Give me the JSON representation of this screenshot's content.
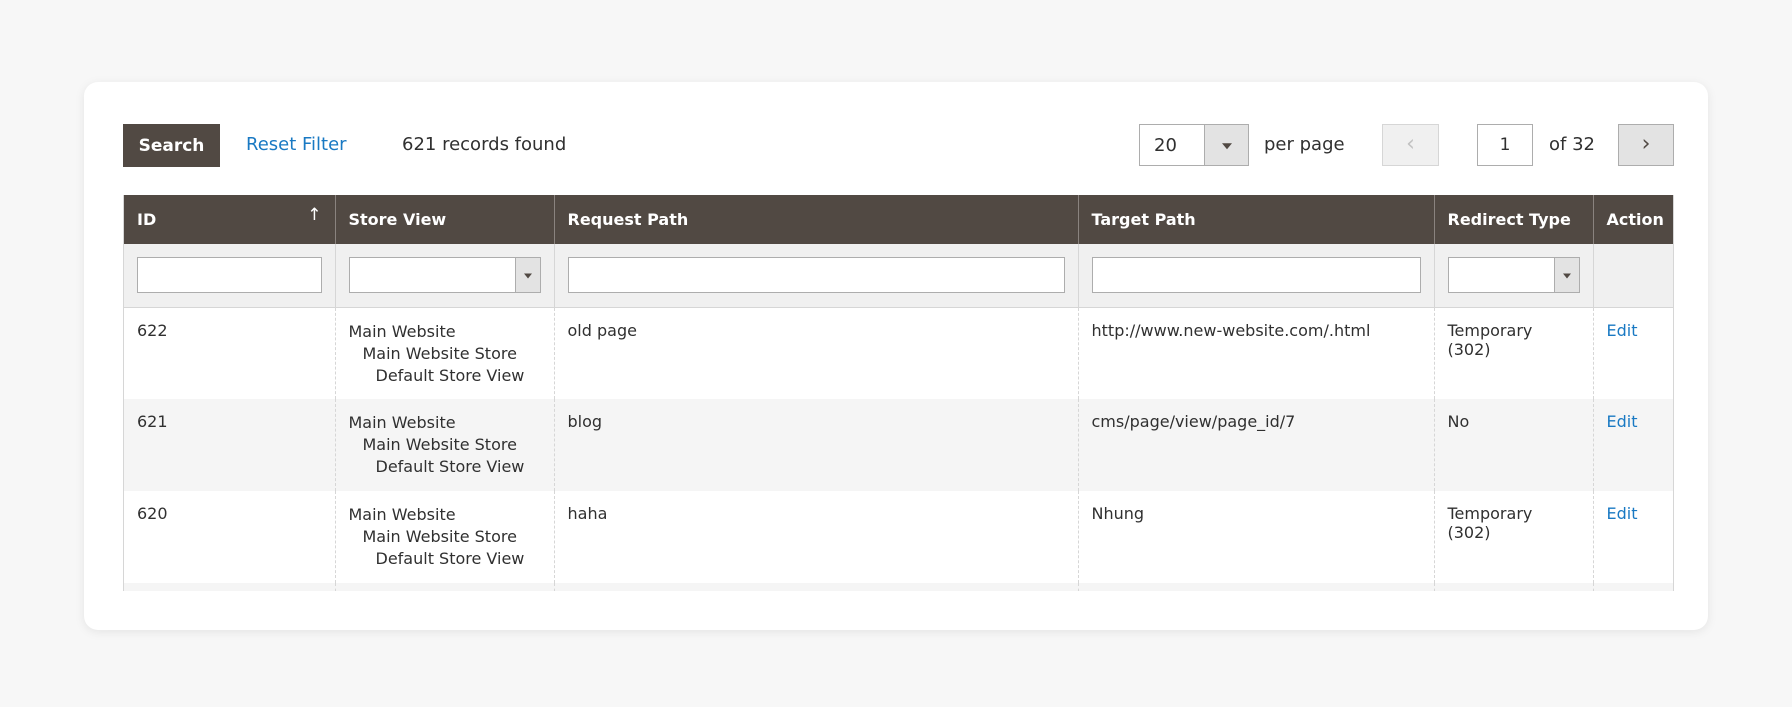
{
  "toolbar": {
    "search_label": "Search",
    "reset_label": "Reset Filter",
    "records_text": "621 records found",
    "per_page_value": "20",
    "per_page_label": "per page",
    "page_value": "1",
    "of_label": "of 32",
    "prev_symbol": "‹",
    "next_symbol": "›"
  },
  "grid": {
    "columns": [
      "ID",
      "Store View",
      "Request Path",
      "Target Path",
      "Redirect Type",
      "Action"
    ],
    "sort_symbol": "↑",
    "rows": [
      {
        "id": "622",
        "store_view": [
          "Main Website",
          "Main Website Store",
          "Default Store View"
        ],
        "request_path": "old page",
        "target_path": "http://www.new-website.com/.html",
        "redirect_type": "Temporary (302)",
        "action": "Edit"
      },
      {
        "id": "621",
        "store_view": [
          "Main Website",
          "Main Website Store",
          "Default Store View"
        ],
        "request_path": "blog",
        "target_path": "cms/page/view/page_id/7",
        "redirect_type": "No",
        "action": "Edit"
      },
      {
        "id": "620",
        "store_view": [
          "Main Website",
          "Main Website Store",
          "Default Store View"
        ],
        "request_path": "haha",
        "target_path": "Nhung",
        "redirect_type": "Temporary (302)",
        "action": "Edit"
      }
    ]
  },
  "colors": {
    "header_bg": "#514943",
    "link": "#1979c3",
    "page_bg": "#f7f7f7"
  }
}
